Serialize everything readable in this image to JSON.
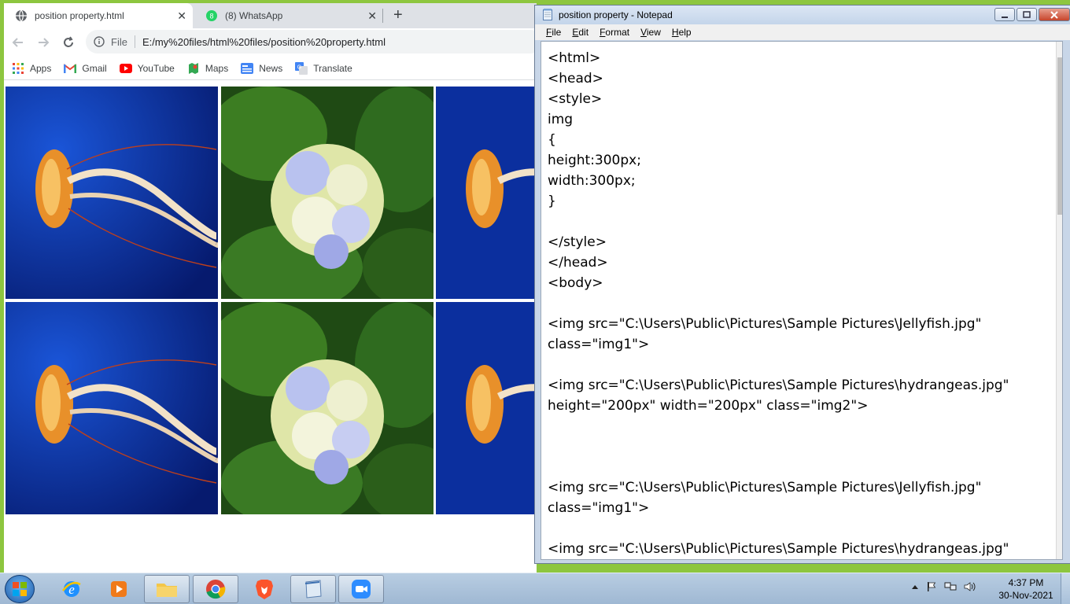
{
  "browser": {
    "tabs": [
      {
        "title": "position property.html",
        "active": true
      },
      {
        "title": "(8) WhatsApp",
        "active": false
      }
    ],
    "close_glyph": "✕",
    "new_tab_glyph": "+",
    "address": {
      "security_label": "File",
      "url": "E:/my%20files/html%20files/position%20property.html"
    },
    "bookmarks": [
      {
        "label": "Apps",
        "icon": "apps-grid-icon"
      },
      {
        "label": "Gmail",
        "icon": "gmail-icon"
      },
      {
        "label": "YouTube",
        "icon": "youtube-icon"
      },
      {
        "label": "Maps",
        "icon": "maps-icon"
      },
      {
        "label": "News",
        "icon": "news-icon"
      },
      {
        "label": "Translate",
        "icon": "translate-icon"
      }
    ],
    "content": {
      "images": [
        "jellyfish",
        "hydrangea",
        "jellyfish",
        "jellyfish",
        "hydrangea",
        "jellyfish"
      ]
    }
  },
  "notepad": {
    "title": "position property - Notepad",
    "menu": [
      "File",
      "Edit",
      "Format",
      "View",
      "Help"
    ],
    "lines": [
      "<html>",
      "<head>",
      "<style>",
      "img",
      "{",
      "height:300px;",
      "width:300px;",
      "}",
      "",
      "</style>",
      "</head>",
      "<body>",
      "",
      "<img src=\"C:\\Users\\Public\\Pictures\\Sample Pictures\\Jellyfish.jpg\"",
      "class=\"img1\">",
      "",
      "<img src=\"C:\\Users\\Public\\Pictures\\Sample Pictures\\hydrangeas.jpg\"",
      "height=\"200px\" width=\"200px\" class=\"img2\">",
      "",
      "",
      "",
      "<img src=\"C:\\Users\\Public\\Pictures\\Sample Pictures\\Jellyfish.jpg\"",
      "class=\"img1\">",
      "",
      "<img src=\"C:\\Users\\Public\\Pictures\\Sample Pictures\\hydrangeas.jpg\""
    ]
  },
  "taskbar": {
    "items": [
      {
        "name": "internet-explorer",
        "open": false
      },
      {
        "name": "media-player",
        "open": false
      },
      {
        "name": "file-explorer",
        "open": true
      },
      {
        "name": "chrome",
        "open": true
      },
      {
        "name": "brave",
        "open": false
      },
      {
        "name": "notepad",
        "open": true
      },
      {
        "name": "zoom",
        "open": true
      }
    ],
    "clock": {
      "time": "4:37 PM",
      "date": "30-Nov-2021"
    }
  },
  "colors": {
    "desktop_accent": "#8dc63f",
    "chrome_tabstrip": "#dee1e6",
    "taskbar": "#a9c0d9",
    "jellyfish_bg": "#0b2f9e",
    "hydrangea_leaf": "#2f6b1f"
  }
}
